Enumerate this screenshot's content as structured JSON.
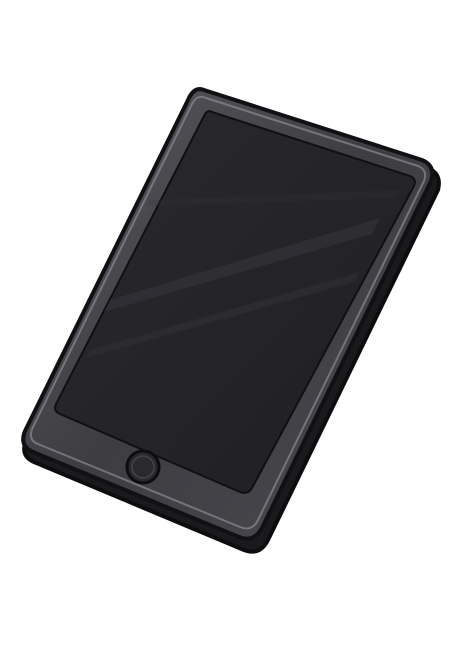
{
  "illustration": {
    "subject": "tablet-device",
    "icon": "tablet-icon",
    "colors": {
      "background": "#ffffff",
      "body": "#3d3d42",
      "body_highlight": "#8a8a92",
      "outline": "#111114",
      "screen": "#232326",
      "screen_shine": "#3a3a40",
      "home_button": "#2a2a2e"
    },
    "home_button_icon": "home-button-icon"
  }
}
